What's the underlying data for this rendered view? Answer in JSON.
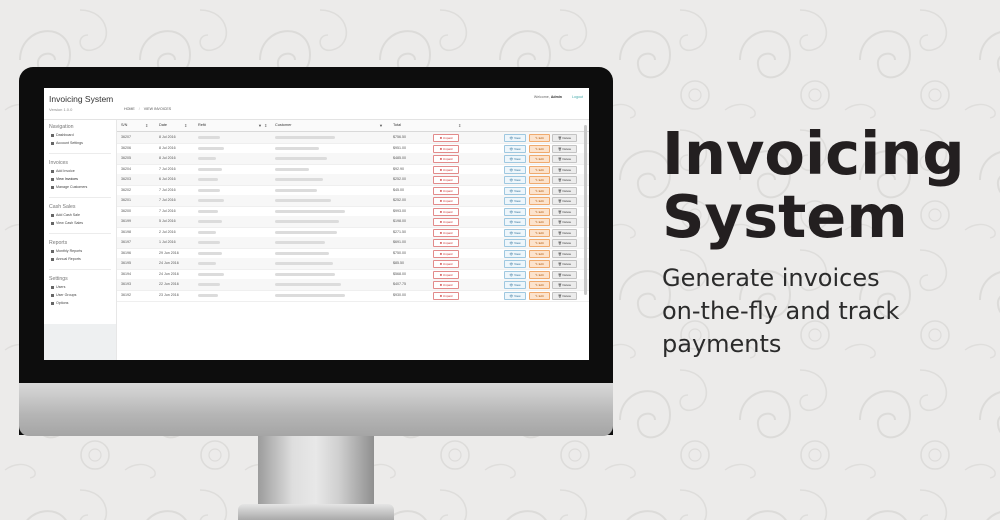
{
  "promo": {
    "headline_line1": "Invoicing",
    "headline_line2": "System",
    "tagline_line1": "Generate invoices",
    "tagline_line2": "on-the-fly and track",
    "tagline_line3": "payments"
  },
  "app": {
    "title": "Invoicing System",
    "version": "Version 1.0.0",
    "breadcrumb": {
      "home": "HOME",
      "sep": "/",
      "current": "VIEW INVOICES"
    },
    "welcome_prefix": "Welcome,",
    "welcome_user": "Admin",
    "logout": "Logout"
  },
  "sidebar": {
    "sections": [
      {
        "title": "Navigation",
        "items": [
          {
            "label": "Dashboard",
            "icon": "home-icon"
          },
          {
            "label": "Account Settings",
            "icon": "gear-icon"
          }
        ]
      },
      {
        "title": "Invoices",
        "items": [
          {
            "label": "Add Invoice",
            "icon": "plus-icon"
          },
          {
            "label": "View Invoices",
            "icon": "list-icon"
          },
          {
            "label": "Manage Customers",
            "icon": "users-icon"
          }
        ]
      },
      {
        "title": "Cash Sales",
        "items": [
          {
            "label": "Add Cash Sale",
            "icon": "plus-icon"
          },
          {
            "label": "View Cash Sales",
            "icon": "list-icon"
          }
        ]
      },
      {
        "title": "Reports",
        "items": [
          {
            "label": "Monthly Reports",
            "icon": "file-icon"
          },
          {
            "label": "Annual Reports",
            "icon": "calendar-icon"
          }
        ]
      },
      {
        "title": "Settings",
        "items": [
          {
            "label": "Users",
            "icon": "user-icon"
          },
          {
            "label": "User Groups",
            "icon": "users-icon"
          },
          {
            "label": "Options",
            "icon": "wrench-icon"
          }
        ]
      }
    ]
  },
  "table": {
    "columns": {
      "sn": "S/N",
      "date": "Date",
      "ref": "Ref#",
      "customer": "Customer",
      "total": "Total"
    },
    "sort_glyph": "⇕",
    "filter_glyph": "▼",
    "status_label": "✖ Unpaid",
    "view_label": "👁 View",
    "edit_label": "✎ Edit",
    "delete_label": "🗑 Delete",
    "rows": [
      {
        "sn": "36207",
        "date": "8 Jul 2016",
        "total": "$756.50"
      },
      {
        "sn": "36206",
        "date": "8 Jul 2016",
        "total": "$951.00"
      },
      {
        "sn": "36205",
        "date": "8 Jul 2016",
        "total": "$485.00"
      },
      {
        "sn": "36204",
        "date": "7 Jul 2016",
        "total": "$92.90"
      },
      {
        "sn": "36203",
        "date": "6 Jul 2016",
        "total": "$252.00"
      },
      {
        "sn": "36202",
        "date": "7 Jul 2016",
        "total": "$45.00"
      },
      {
        "sn": "36201",
        "date": "7 Jul 2016",
        "total": "$252.00"
      },
      {
        "sn": "36200",
        "date": "7 Jul 2016",
        "total": "$993.00"
      },
      {
        "sn": "36199",
        "date": "5 Jul 2016",
        "total": "$198.00"
      },
      {
        "sn": "36198",
        "date": "2 Jul 2016",
        "total": "$271.50"
      },
      {
        "sn": "36197",
        "date": "1 Jul 2016",
        "total": "$691.00"
      },
      {
        "sn": "36196",
        "date": "29 Jun 2016",
        "total": "$750.00"
      },
      {
        "sn": "36195",
        "date": "24 Jun 2016",
        "total": "$85.50"
      },
      {
        "sn": "36194",
        "date": "24 Jun 2016",
        "total": "$568.00"
      },
      {
        "sn": "36193",
        "date": "22 Jun 2016",
        "total": "$407.75"
      },
      {
        "sn": "36192",
        "date": "23 Jun 2016",
        "total": "$930.00"
      }
    ]
  }
}
